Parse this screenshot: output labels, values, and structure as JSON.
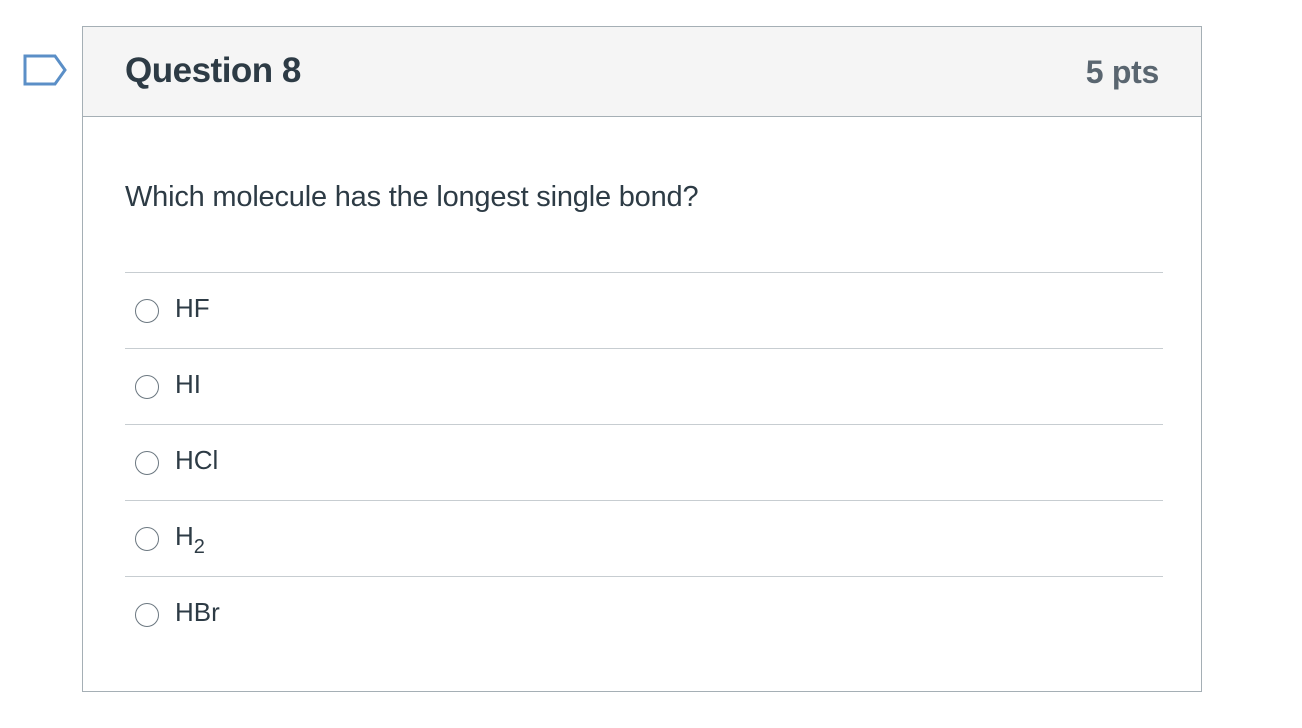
{
  "question": {
    "title": "Question 8",
    "points": "5 pts",
    "text": "Which molecule has the longest single bond?",
    "flag_icon": "flag-outline-icon"
  },
  "answers": [
    {
      "label": "HF",
      "sub": ""
    },
    {
      "label": "HI",
      "sub": ""
    },
    {
      "label": "HCl",
      "sub": ""
    },
    {
      "label": "H",
      "sub": "2"
    },
    {
      "label": "HBr",
      "sub": ""
    }
  ],
  "colors": {
    "header_bg": "#f5f5f5",
    "border": "#a5afb5",
    "text": "#2d3b45",
    "points": "#5a6670",
    "flag": "#5b9bd5"
  }
}
